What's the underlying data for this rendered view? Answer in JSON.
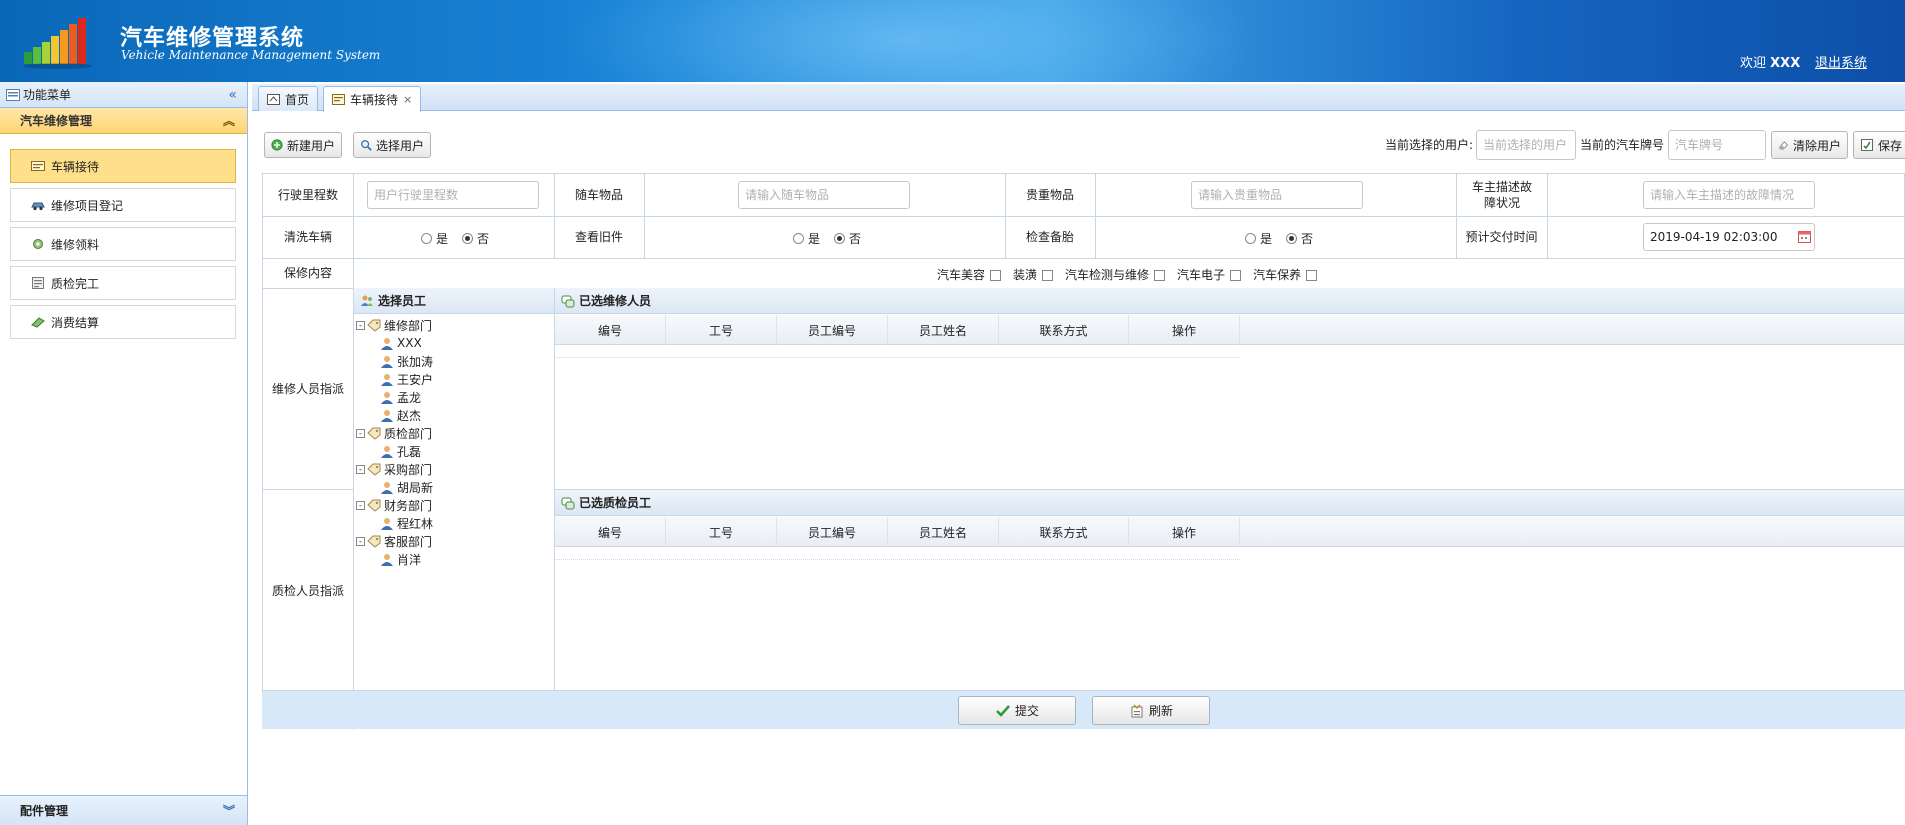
{
  "header": {
    "title": "汽车维修管理系统",
    "subtitle": "Vehicle Maintenance Management System",
    "welcome_prefix": "欢迎",
    "username": "XXX",
    "logout": "退出系统"
  },
  "sidebar": {
    "title": "功能菜单",
    "group": "汽车维修管理",
    "items": [
      {
        "label": "车辆接待",
        "icon": "reception-icon"
      },
      {
        "label": "维修项目登记",
        "icon": "car-icon"
      },
      {
        "label": "维修领料",
        "icon": "parts-icon"
      },
      {
        "label": "质检完工",
        "icon": "inspection-icon"
      },
      {
        "label": "消费结算",
        "icon": "settlement-icon"
      }
    ],
    "footer": "配件管理"
  },
  "tabs": [
    {
      "label": "首页"
    },
    {
      "label": "车辆接待",
      "close": "×"
    }
  ],
  "toolbar": {
    "new_user": "新建用户",
    "select_user": "选择用户",
    "current_user_label": "当前选择的用户:",
    "current_user_placeholder": "当前选择的用户",
    "current_plate_label": "当前的汽车牌号",
    "plate_placeholder": "汽车牌号",
    "clear_user": "清除用户",
    "save": "保存"
  },
  "form": {
    "mileage_label": "行驶里程数",
    "mileage_placeholder": "用户行驶里程数",
    "belongings_label": "随车物品",
    "belongings_placeholder": "请输入随车物品",
    "valuables_label": "贵重物品",
    "valuables_placeholder": "请输入贵重物品",
    "fault_label": "车主描述故障状况",
    "fault_placeholder": "请输入车主描述的故障情况",
    "wash_label": "清洗车辆",
    "old_parts_label": "查看旧件",
    "spare_tire_label": "检查备胎",
    "yes": "是",
    "no": "否",
    "delivery_label": "预计交付时间",
    "delivery_value": "2019-04-19 02:03:00",
    "warranty_label": "保修内容",
    "warranty_options": [
      "汽车美容",
      "装潢",
      "汽车检测与维修",
      "汽车电子",
      "汽车保养"
    ],
    "repair_assign_label": "维修人员指派",
    "qc_assign_label": "质检人员指派"
  },
  "employee_tree": {
    "title": "选择员工",
    "departments": [
      {
        "name": "维修部门",
        "staff": [
          "XXX",
          "张加涛",
          "王安户",
          "孟龙",
          "赵杰"
        ]
      },
      {
        "name": "质检部门",
        "staff": [
          "孔磊"
        ]
      },
      {
        "name": "采购部门",
        "staff": [
          "胡局新"
        ]
      },
      {
        "name": "财务部门",
        "staff": [
          "程红林"
        ]
      },
      {
        "name": "客服部门",
        "staff": [
          "肖洋"
        ]
      }
    ]
  },
  "repair_panel": {
    "title": "已选维修人员",
    "columns": [
      "编号",
      "工号",
      "员工编号",
      "员工姓名",
      "联系方式",
      "操作"
    ]
  },
  "qc_panel": {
    "title": "已选质检员工",
    "columns": [
      "编号",
      "工号",
      "员工编号",
      "员工姓名",
      "联系方式",
      "操作"
    ]
  },
  "actions": {
    "submit": "提交",
    "refresh": "刷新"
  },
  "colors": {
    "header_blue": "#1b86d8",
    "active_yellow": "#ffe08a",
    "border_blue": "#99bbe8"
  }
}
